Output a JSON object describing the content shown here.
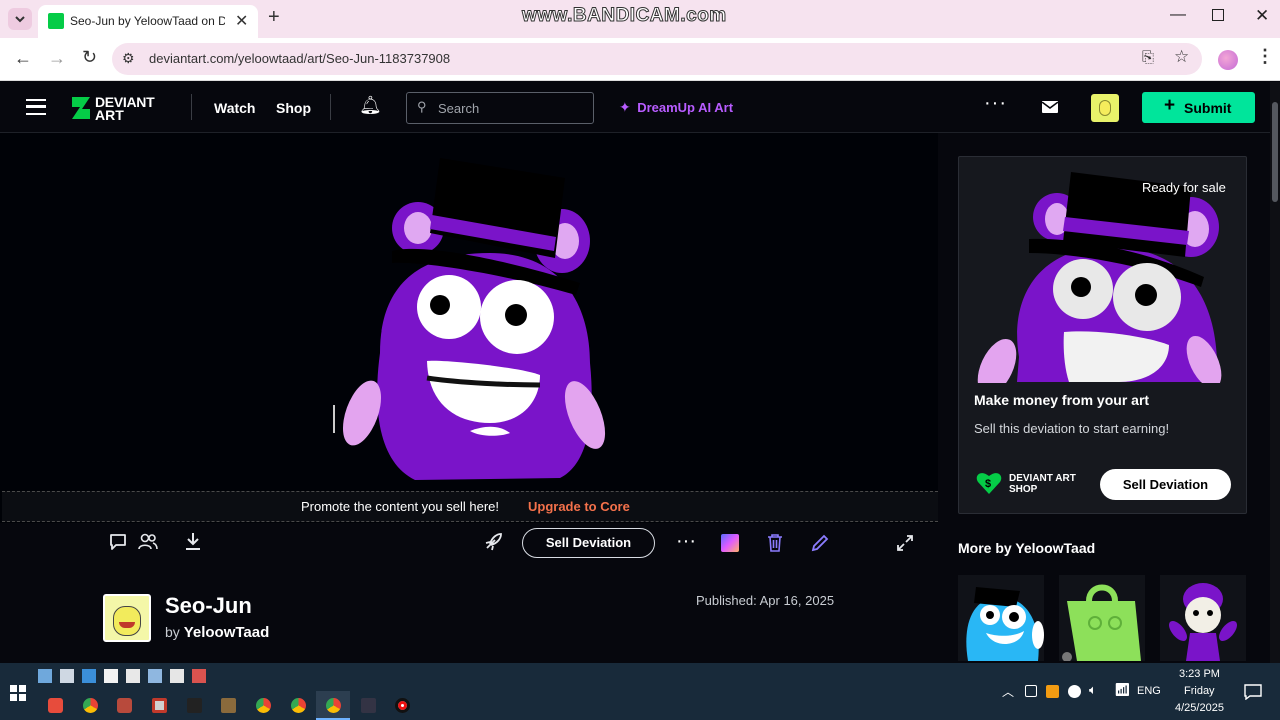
{
  "browser": {
    "tab_title": "Seo-Jun by YeloowTaad on Devi",
    "url": "deviantart.com/yeloowtaad/art/Seo-Jun-1183737908",
    "watermark": "www.BANDICAM.com"
  },
  "header": {
    "logo_text_1": "DEVIANT",
    "logo_text_2": "ART",
    "nav": [
      "Watch",
      "Shop"
    ],
    "search_placeholder": "Search",
    "dreamup_label": "DreamUp AI Art",
    "submit_label": "Submit"
  },
  "viewer": {
    "promo_text": "Promote the content you sell here!",
    "promo_link": "Upgrade to Core",
    "sell_label": "Sell Deviation"
  },
  "deviation": {
    "title": "Seo-Jun",
    "by_prefix": "by",
    "author": "YeloowTaad",
    "published": "Published: Apr 16, 2025"
  },
  "shop_card": {
    "badge": "Ready for sale",
    "heading": "Make money from your art",
    "subtext": "Sell this deviation to start earning!",
    "shop_logo_1": "DEVIANT ART",
    "shop_logo_2": "SHOP",
    "sell_label": "Sell Deviation"
  },
  "more_by": {
    "heading": "More by YeloowTaad"
  },
  "taskbar": {
    "time": "3:23 PM",
    "day": "Friday",
    "date": "4/25/2025",
    "lang": "ENG"
  },
  "colors": {
    "accent_green": "#00e59b",
    "dreamup_purple": "#b85cff",
    "upgrade_orange": "#f4714b",
    "character_purple": "#7a14c9"
  }
}
